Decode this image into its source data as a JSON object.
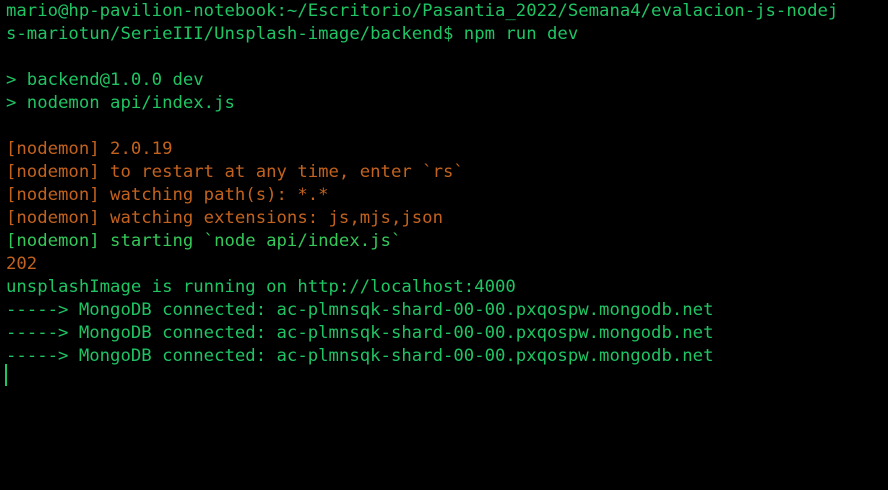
{
  "terminal": {
    "lines": [
      {
        "text": "mario@hp-pavilion-notebook:~/Escritorio/Pasantia_2022/Semana4/evalacion-js-nodej",
        "color": "#1fc463"
      },
      {
        "text": "s-mariotun/SerieIII/Unsplash-image/backend$ npm run dev",
        "color": "#1fc463"
      },
      {
        "text": "",
        "color": "#1fc463"
      },
      {
        "text": "> backend@1.0.0 dev",
        "color": "#1fc463"
      },
      {
        "text": "> nodemon api/index.js",
        "color": "#1fc463"
      },
      {
        "text": "",
        "color": "#1fc463"
      },
      {
        "text": "[nodemon] 2.0.19",
        "color": "#c2621e"
      },
      {
        "text": "[nodemon] to restart at any time, enter `rs`",
        "color": "#c2621e"
      },
      {
        "text": "[nodemon] watching path(s): *.*",
        "color": "#c2621e"
      },
      {
        "text": "[nodemon] watching extensions: js,mjs,json",
        "color": "#c2621e"
      },
      {
        "text": "[nodemon] starting `node api/index.js`",
        "color": "#34c759"
      },
      {
        "text": "202",
        "color": "#c2621e"
      },
      {
        "text": "unsplashImage is running on http://localhost:4000",
        "color": "#1fc463"
      },
      {
        "text": "-----> MongoDB connected: ac-plmnsqk-shard-00-00.pxqospw.mongodb.net",
        "color": "#1fc463"
      },
      {
        "text": "-----> MongoDB connected: ac-plmnsqk-shard-00-00.pxqospw.mongodb.net",
        "color": "#1fc463"
      },
      {
        "text": "-----> MongoDB connected: ac-plmnsqk-shard-00-00.pxqospw.mongodb.net",
        "color": "#1fc463"
      }
    ]
  },
  "colors": {
    "background": "#000000",
    "prompt_green": "#1fc463",
    "nodemon_orange": "#c2621e",
    "nodemon_start_green": "#34c759"
  }
}
